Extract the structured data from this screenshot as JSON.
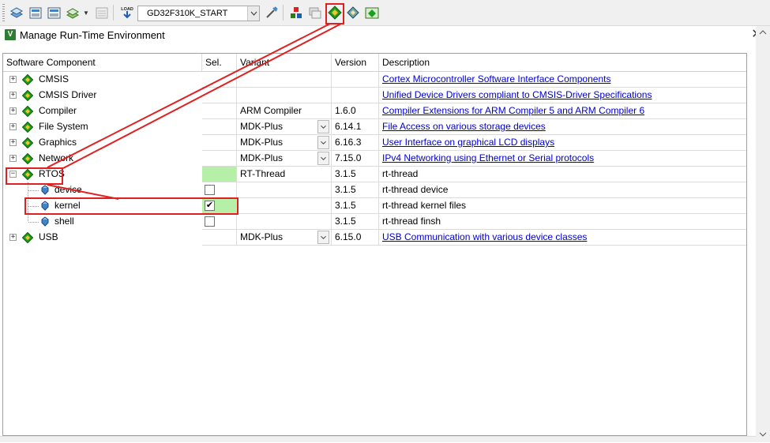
{
  "toolbar": {
    "target": "GD32F310K_START",
    "buttons": [
      {
        "name": "translate-icon"
      },
      {
        "name": "build-icon"
      },
      {
        "name": "rebuild-icon"
      },
      {
        "name": "batch-build-icon"
      },
      {
        "name": "stop-build-icon"
      },
      {
        "name": "download-icon",
        "text": "LOAD"
      },
      {
        "name": "target-options-icon"
      },
      {
        "name": "file-extensions-icon"
      },
      {
        "name": "books-icon"
      },
      {
        "name": "manage-run-time-environment-icon"
      },
      {
        "name": "select-software-packs-icon"
      },
      {
        "name": "pack-installer-icon"
      }
    ]
  },
  "window": {
    "title": "Manage Run-Time Environment",
    "icon_letter": "V",
    "close": "✕"
  },
  "grid": {
    "headers": {
      "component": "Software Component",
      "sel": "Sel.",
      "variant": "Variant",
      "version": "Version",
      "description": "Description"
    },
    "rows": [
      {
        "name": "CMSIS",
        "level": 0,
        "expander": "+",
        "sel": "",
        "variant": "",
        "dropdown": false,
        "version": "",
        "description": "Cortex Microcontroller Software Interface Components",
        "link": true
      },
      {
        "name": "CMSIS Driver",
        "level": 0,
        "expander": "+",
        "sel": "",
        "variant": "",
        "dropdown": false,
        "version": "",
        "description": "Unified Device Drivers compliant to CMSIS-Driver Specifications",
        "link": true
      },
      {
        "name": "Compiler",
        "level": 0,
        "expander": "+",
        "sel": "",
        "variant": "ARM Compiler",
        "dropdown": false,
        "version": "1.6.0",
        "description": "Compiler Extensions for ARM Compiler 5 and ARM Compiler 6",
        "link": true
      },
      {
        "name": "File System",
        "level": 0,
        "expander": "+",
        "sel": "",
        "variant": "MDK-Plus",
        "dropdown": true,
        "version": "6.14.1",
        "description": "File Access on various storage devices",
        "link": true
      },
      {
        "name": "Graphics",
        "level": 0,
        "expander": "+",
        "sel": "",
        "variant": "MDK-Plus",
        "dropdown": true,
        "version": "6.16.3",
        "description": "User Interface on graphical LCD displays",
        "link": true
      },
      {
        "name": "Network",
        "level": 0,
        "expander": "+",
        "sel": "",
        "variant": "MDK-Plus",
        "dropdown": true,
        "version": "7.15.0",
        "description": "IPv4 Networking using Ethernet or Serial protocols",
        "link": true
      },
      {
        "name": "RTOS",
        "level": 0,
        "expander": "−",
        "sel": "",
        "sel_green": true,
        "variant": "RT-Thread",
        "dropdown": false,
        "version": "3.1.5",
        "description": "rt-thread",
        "link": false
      },
      {
        "name": "device",
        "level": 1,
        "checkbox": true,
        "checked": false,
        "sel": "",
        "variant": "",
        "dropdown": false,
        "version": "3.1.5",
        "description": "rt-thread device",
        "link": false
      },
      {
        "name": "kernel",
        "level": 1,
        "checkbox": true,
        "checked": true,
        "sel": "✔",
        "sel_green": true,
        "variant": "",
        "dropdown": false,
        "version": "3.1.5",
        "description": "rt-thread kernel files",
        "link": false
      },
      {
        "name": "shell",
        "level": 1,
        "checkbox": true,
        "checked": false,
        "sel": "",
        "variant": "",
        "dropdown": false,
        "version": "3.1.5",
        "description": "rt-thread finsh",
        "link": false
      },
      {
        "name": "USB",
        "level": 0,
        "expander": "+",
        "sel": "",
        "variant": "MDK-Plus",
        "dropdown": true,
        "version": "6.15.0",
        "description": "USB Communication with various device classes",
        "link": true
      }
    ]
  },
  "colors": {
    "annotation": "#e02020",
    "selection_green": "#b6f0a8",
    "link": "#0000cc",
    "gem_green": "#1aa01a"
  }
}
